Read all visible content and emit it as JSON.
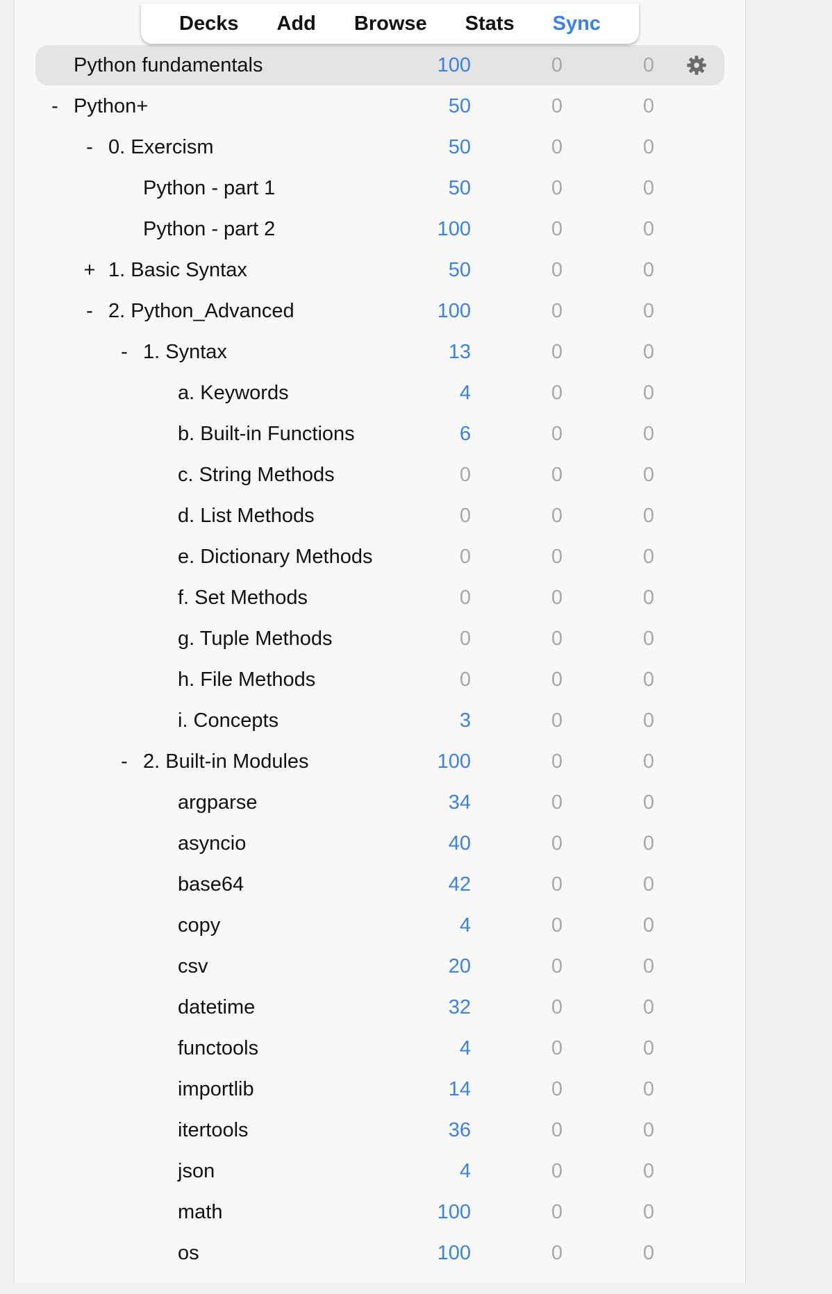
{
  "toolbar": {
    "items": [
      {
        "label": "Decks",
        "active": false
      },
      {
        "label": "Add",
        "active": false
      },
      {
        "label": "Browse",
        "active": false
      },
      {
        "label": "Stats",
        "active": false
      },
      {
        "label": "Sync",
        "active": true
      }
    ]
  },
  "colors": {
    "accent": "#3b82e6",
    "zero": "#a8a8a8",
    "text": "#111111"
  },
  "decks": [
    {
      "name": "Python fundamentals",
      "toggle": "",
      "depth": 0,
      "new": "100",
      "learn": "0",
      "due": "0",
      "current": true,
      "gear_icon": "gear-icon"
    },
    {
      "name": "Python+",
      "toggle": "-",
      "depth": 0,
      "new": "50",
      "learn": "0",
      "due": "0"
    },
    {
      "name": "0. Exercism",
      "toggle": "-",
      "depth": 1,
      "new": "50",
      "learn": "0",
      "due": "0"
    },
    {
      "name": "Python - part 1",
      "toggle": "",
      "depth": 2,
      "new": "50",
      "learn": "0",
      "due": "0"
    },
    {
      "name": "Python - part 2",
      "toggle": "",
      "depth": 2,
      "new": "100",
      "learn": "0",
      "due": "0"
    },
    {
      "name": "1. Basic Syntax",
      "toggle": "+",
      "depth": 1,
      "new": "50",
      "learn": "0",
      "due": "0"
    },
    {
      "name": "2. Python_Advanced",
      "toggle": "-",
      "depth": 1,
      "new": "100",
      "learn": "0",
      "due": "0"
    },
    {
      "name": "1. Syntax",
      "toggle": "-",
      "depth": 2,
      "new": "13",
      "learn": "0",
      "due": "0"
    },
    {
      "name": "a. Keywords",
      "toggle": "",
      "depth": 3,
      "new": "4",
      "learn": "0",
      "due": "0"
    },
    {
      "name": "b. Built-in Functions",
      "toggle": "",
      "depth": 3,
      "new": "6",
      "learn": "0",
      "due": "0"
    },
    {
      "name": "c. String Methods",
      "toggle": "",
      "depth": 3,
      "new": "0",
      "learn": "0",
      "due": "0"
    },
    {
      "name": "d. List Methods",
      "toggle": "",
      "depth": 3,
      "new": "0",
      "learn": "0",
      "due": "0"
    },
    {
      "name": "e. Dictionary Methods",
      "toggle": "",
      "depth": 3,
      "new": "0",
      "learn": "0",
      "due": "0"
    },
    {
      "name": "f. Set Methods",
      "toggle": "",
      "depth": 3,
      "new": "0",
      "learn": "0",
      "due": "0"
    },
    {
      "name": "g. Tuple Methods",
      "toggle": "",
      "depth": 3,
      "new": "0",
      "learn": "0",
      "due": "0"
    },
    {
      "name": "h. File Methods",
      "toggle": "",
      "depth": 3,
      "new": "0",
      "learn": "0",
      "due": "0"
    },
    {
      "name": "i. Concepts",
      "toggle": "",
      "depth": 3,
      "new": "3",
      "learn": "0",
      "due": "0"
    },
    {
      "name": "2. Built-in Modules",
      "toggle": "-",
      "depth": 2,
      "new": "100",
      "learn": "0",
      "due": "0"
    },
    {
      "name": "argparse",
      "toggle": "",
      "depth": 3,
      "new": "34",
      "learn": "0",
      "due": "0"
    },
    {
      "name": "asyncio",
      "toggle": "",
      "depth": 3,
      "new": "40",
      "learn": "0",
      "due": "0"
    },
    {
      "name": "base64",
      "toggle": "",
      "depth": 3,
      "new": "42",
      "learn": "0",
      "due": "0"
    },
    {
      "name": "copy",
      "toggle": "",
      "depth": 3,
      "new": "4",
      "learn": "0",
      "due": "0"
    },
    {
      "name": "csv",
      "toggle": "",
      "depth": 3,
      "new": "20",
      "learn": "0",
      "due": "0"
    },
    {
      "name": "datetime",
      "toggle": "",
      "depth": 3,
      "new": "32",
      "learn": "0",
      "due": "0"
    },
    {
      "name": "functools",
      "toggle": "",
      "depth": 3,
      "new": "4",
      "learn": "0",
      "due": "0"
    },
    {
      "name": "importlib",
      "toggle": "",
      "depth": 3,
      "new": "14",
      "learn": "0",
      "due": "0"
    },
    {
      "name": "itertools",
      "toggle": "",
      "depth": 3,
      "new": "36",
      "learn": "0",
      "due": "0"
    },
    {
      "name": "json",
      "toggle": "",
      "depth": 3,
      "new": "4",
      "learn": "0",
      "due": "0"
    },
    {
      "name": "math",
      "toggle": "",
      "depth": 3,
      "new": "100",
      "learn": "0",
      "due": "0"
    },
    {
      "name": "os",
      "toggle": "",
      "depth": 3,
      "new": "100",
      "learn": "0",
      "due": "0"
    }
  ]
}
